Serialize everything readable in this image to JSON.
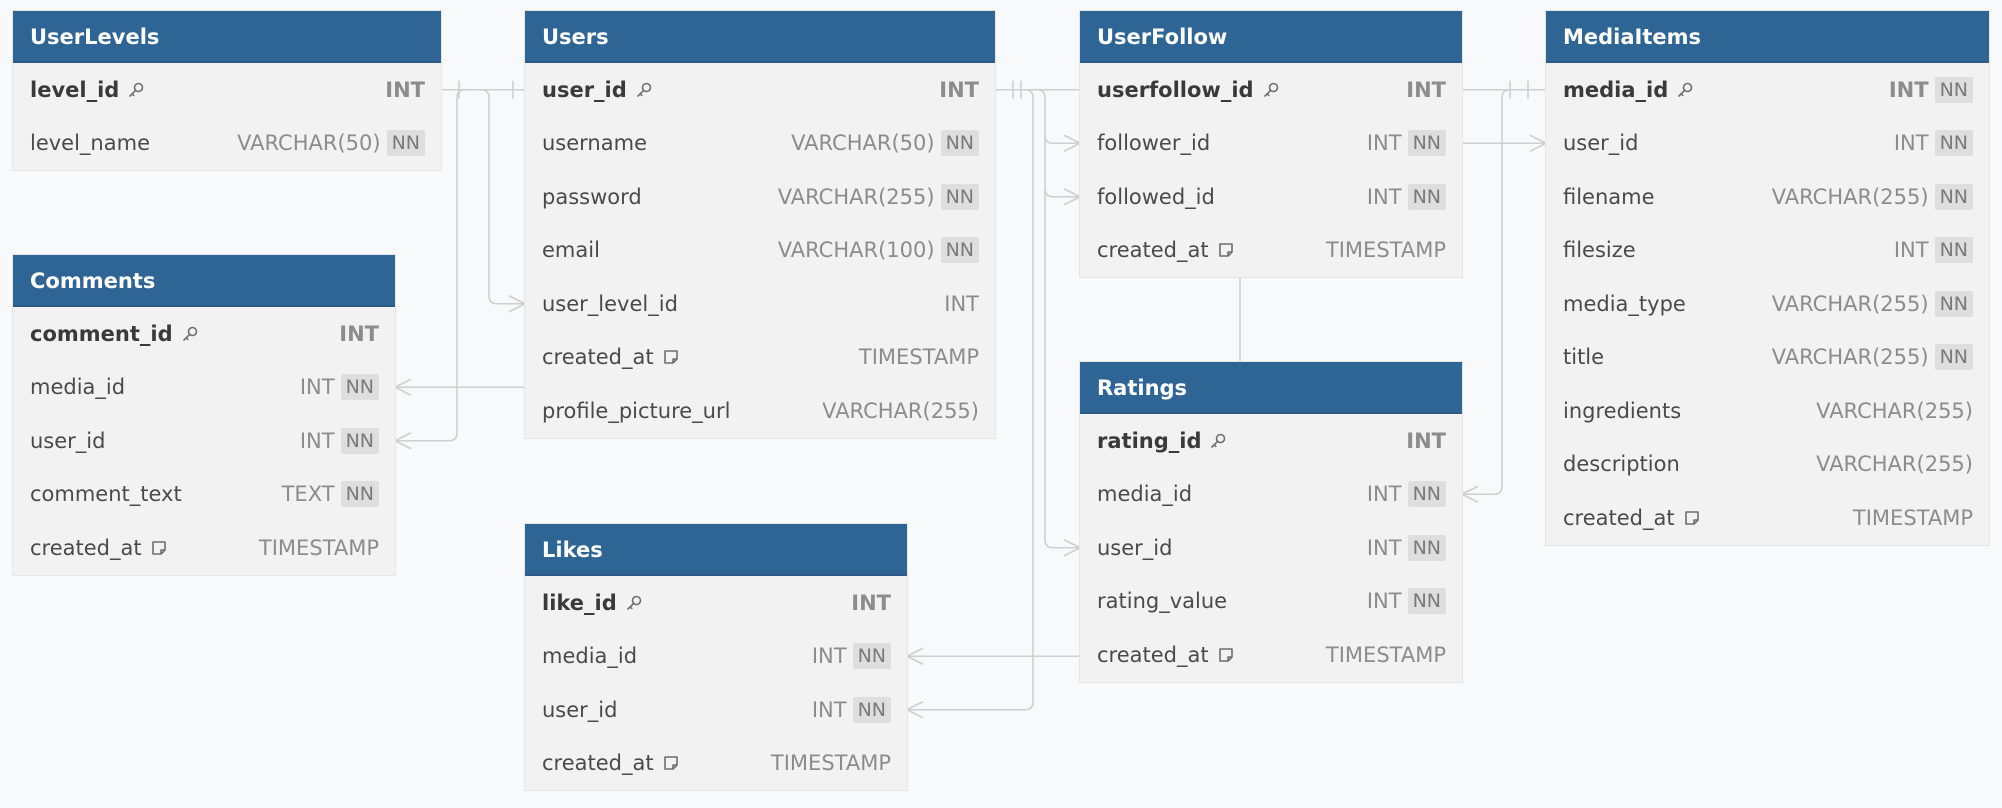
{
  "tables": [
    {
      "id": "UserLevels",
      "name": "UserLevels",
      "columns": [
        {
          "name": "level_id",
          "type": "INT",
          "pk": true,
          "nn": false,
          "note": false
        },
        {
          "name": "level_name",
          "type": "VARCHAR(50)",
          "pk": false,
          "nn": true,
          "note": false
        }
      ]
    },
    {
      "id": "Comments",
      "name": "Comments",
      "columns": [
        {
          "name": "comment_id",
          "type": "INT",
          "pk": true,
          "nn": false,
          "note": false
        },
        {
          "name": "media_id",
          "type": "INT",
          "pk": false,
          "nn": true,
          "note": false
        },
        {
          "name": "user_id",
          "type": "INT",
          "pk": false,
          "nn": true,
          "note": false
        },
        {
          "name": "comment_text",
          "type": "TEXT",
          "pk": false,
          "nn": true,
          "note": false
        },
        {
          "name": "created_at",
          "type": "TIMESTAMP",
          "pk": false,
          "nn": false,
          "note": true
        }
      ]
    },
    {
      "id": "Users",
      "name": "Users",
      "columns": [
        {
          "name": "user_id",
          "type": "INT",
          "pk": true,
          "nn": false,
          "note": false
        },
        {
          "name": "username",
          "type": "VARCHAR(50)",
          "pk": false,
          "nn": true,
          "note": false
        },
        {
          "name": "password",
          "type": "VARCHAR(255)",
          "pk": false,
          "nn": true,
          "note": false
        },
        {
          "name": "email",
          "type": "VARCHAR(100)",
          "pk": false,
          "nn": true,
          "note": false
        },
        {
          "name": "user_level_id",
          "type": "INT",
          "pk": false,
          "nn": false,
          "note": false
        },
        {
          "name": "created_at",
          "type": "TIMESTAMP",
          "pk": false,
          "nn": false,
          "note": true
        },
        {
          "name": "profile_picture_url",
          "type": "VARCHAR(255)",
          "pk": false,
          "nn": false,
          "note": false
        }
      ]
    },
    {
      "id": "Likes",
      "name": "Likes",
      "columns": [
        {
          "name": "like_id",
          "type": "INT",
          "pk": true,
          "nn": false,
          "note": false
        },
        {
          "name": "media_id",
          "type": "INT",
          "pk": false,
          "nn": true,
          "note": false
        },
        {
          "name": "user_id",
          "type": "INT",
          "pk": false,
          "nn": true,
          "note": false
        },
        {
          "name": "created_at",
          "type": "TIMESTAMP",
          "pk": false,
          "nn": false,
          "note": true
        }
      ]
    },
    {
      "id": "UserFollow",
      "name": "UserFollow",
      "columns": [
        {
          "name": "userfollow_id",
          "type": "INT",
          "pk": true,
          "nn": false,
          "note": false
        },
        {
          "name": "follower_id",
          "type": "INT",
          "pk": false,
          "nn": true,
          "note": false
        },
        {
          "name": "followed_id",
          "type": "INT",
          "pk": false,
          "nn": true,
          "note": false
        },
        {
          "name": "created_at",
          "type": "TIMESTAMP",
          "pk": false,
          "nn": false,
          "note": true
        }
      ]
    },
    {
      "id": "Ratings",
      "name": "Ratings",
      "columns": [
        {
          "name": "rating_id",
          "type": "INT",
          "pk": true,
          "nn": false,
          "note": false
        },
        {
          "name": "media_id",
          "type": "INT",
          "pk": false,
          "nn": true,
          "note": false
        },
        {
          "name": "user_id",
          "type": "INT",
          "pk": false,
          "nn": true,
          "note": false
        },
        {
          "name": "rating_value",
          "type": "INT",
          "pk": false,
          "nn": true,
          "note": false
        },
        {
          "name": "created_at",
          "type": "TIMESTAMP",
          "pk": false,
          "nn": false,
          "note": true
        }
      ]
    },
    {
      "id": "MediaItems",
      "name": "MediaItems",
      "columns": [
        {
          "name": "media_id",
          "type": "INT",
          "pk": true,
          "nn": true,
          "note": false
        },
        {
          "name": "user_id",
          "type": "INT",
          "pk": false,
          "nn": true,
          "note": false
        },
        {
          "name": "filename",
          "type": "VARCHAR(255)",
          "pk": false,
          "nn": true,
          "note": false
        },
        {
          "name": "filesize",
          "type": "INT",
          "pk": false,
          "nn": true,
          "note": false
        },
        {
          "name": "media_type",
          "type": "VARCHAR(255)",
          "pk": false,
          "nn": true,
          "note": false
        },
        {
          "name": "title",
          "type": "VARCHAR(255)",
          "pk": false,
          "nn": true,
          "note": false
        },
        {
          "name": "ingredients",
          "type": "VARCHAR(255)",
          "pk": false,
          "nn": false,
          "note": false
        },
        {
          "name": "description",
          "type": "VARCHAR(255)",
          "pk": false,
          "nn": false,
          "note": false
        },
        {
          "name": "created_at",
          "type": "TIMESTAMP",
          "pk": false,
          "nn": false,
          "note": true
        }
      ]
    }
  ],
  "labels": {
    "not_null_badge": "NN"
  },
  "icons": {
    "primary_key": "key-icon",
    "note": "note-icon"
  },
  "colors": {
    "header": "#2f6594",
    "body": "#f2f2f2",
    "line": "#cfcfcf",
    "canvas": "#f8f9fa"
  },
  "relationships": [
    {
      "from": "UserLevels.level_id",
      "to": "Users.user_level_id",
      "cardinality": "one-to-many"
    },
    {
      "from": "Users.user_id",
      "to": "Comments.user_id",
      "cardinality": "one-to-many"
    },
    {
      "from": "Users.user_id",
      "to": "UserFollow.follower_id",
      "cardinality": "one-to-many"
    },
    {
      "from": "Users.user_id",
      "to": "UserFollow.followed_id",
      "cardinality": "one-to-many"
    },
    {
      "from": "Users.user_id",
      "to": "Ratings.user_id",
      "cardinality": "one-to-many"
    },
    {
      "from": "Users.user_id",
      "to": "Likes.user_id",
      "cardinality": "one-to-many"
    },
    {
      "from": "Users.user_id",
      "to": "MediaItems.user_id",
      "cardinality": "one-to-many"
    },
    {
      "from": "MediaItems.media_id",
      "to": "Comments.media_id",
      "cardinality": "one-to-many"
    },
    {
      "from": "MediaItems.media_id",
      "to": "Likes.media_id",
      "cardinality": "one-to-many"
    },
    {
      "from": "MediaItems.media_id",
      "to": "Ratings.media_id",
      "cardinality": "one-to-many"
    }
  ]
}
